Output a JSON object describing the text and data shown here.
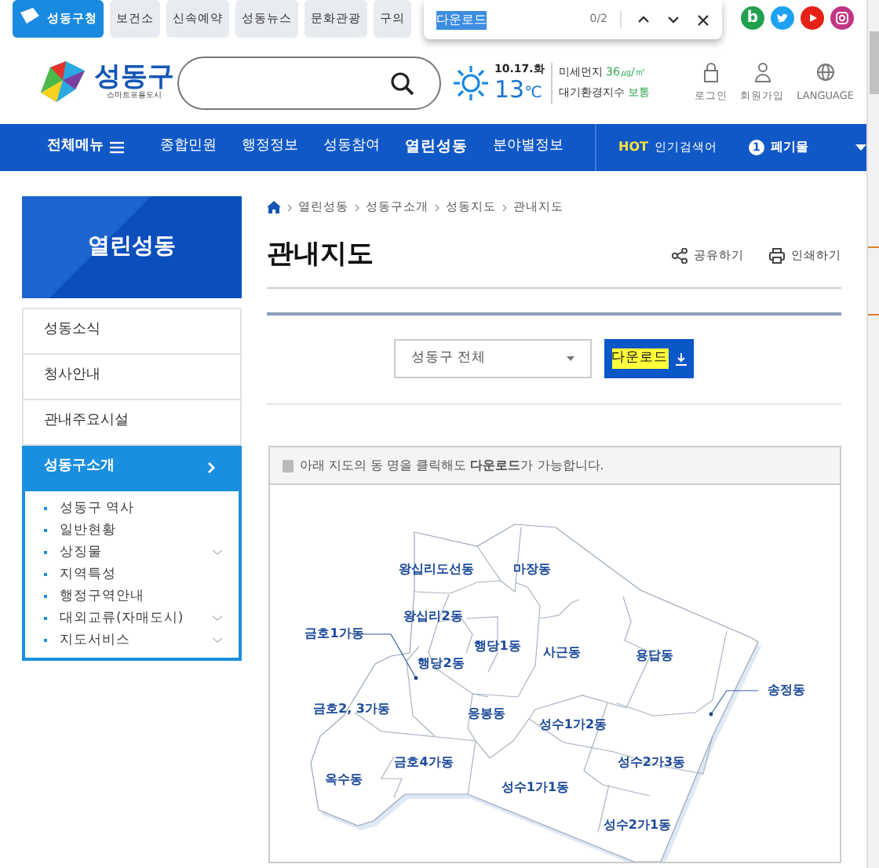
{
  "top_tabs": [
    {
      "label": "성동구청",
      "selected": true
    },
    {
      "label": "보건소",
      "selected": false
    },
    {
      "label": "신속예약",
      "selected": false
    },
    {
      "label": "성동뉴스",
      "selected": false
    },
    {
      "label": "문화관광",
      "selected": false
    },
    {
      "label": "구의",
      "selected": false
    }
  ],
  "find_bar": {
    "query": "다운로드",
    "count": "0/2"
  },
  "social_links": [
    {
      "kind": "blog",
      "glyph": "b"
    },
    {
      "kind": "twitter"
    },
    {
      "kind": "youtube"
    },
    {
      "kind": "instagram"
    }
  ],
  "logo": {
    "name": "성동구",
    "slogan": "스마트포용도시"
  },
  "weather": {
    "date": "10.17.화",
    "temperature": "13",
    "unit": "℃",
    "dust_label": "미세먼지",
    "dust_value": "36㎍/㎥",
    "air_label": "대기환경지수",
    "air_value": "보통"
  },
  "user_links": [
    {
      "kind": "login",
      "label": "로그인"
    },
    {
      "kind": "signup",
      "label": "회원가입"
    },
    {
      "kind": "language",
      "label": "LANGUAGE"
    }
  ],
  "main_nav": {
    "all_menu": "전체메뉴",
    "items": [
      {
        "label": "종합민원",
        "selected": false
      },
      {
        "label": "행정정보",
        "selected": false
      },
      {
        "label": "성동참여",
        "selected": false
      },
      {
        "label": "열린성동",
        "selected": true
      },
      {
        "label": "분야별정보",
        "selected": false
      }
    ],
    "hot_tag": "HOT",
    "hot_label": "인기검색어",
    "hot_rank": "1",
    "hot_keyword": "폐기물"
  },
  "sidebar": {
    "title": "열린성동",
    "items": [
      {
        "label": "성동소식",
        "selected": false
      },
      {
        "label": "청사안내",
        "selected": false
      },
      {
        "label": "관내주요시설",
        "selected": false
      },
      {
        "label": "성동구소개",
        "selected": true,
        "children": [
          {
            "label": "성동구 역사",
            "has_submenu": false
          },
          {
            "label": "일반현황",
            "has_submenu": false
          },
          {
            "label": "상징물",
            "has_submenu": true
          },
          {
            "label": "지역특성",
            "has_submenu": false
          },
          {
            "label": "행정구역안내",
            "has_submenu": false
          },
          {
            "label": "대외교류(자매도시)",
            "has_submenu": true
          },
          {
            "label": "지도서비스",
            "has_submenu": true
          }
        ]
      }
    ]
  },
  "breadcrumb": [
    "열린성동",
    "성동구소개",
    "성동지도",
    "관내지도"
  ],
  "page_title": "관내지도",
  "page_actions": [
    {
      "kind": "share",
      "label": "공유하기"
    },
    {
      "kind": "print",
      "label": "인쇄하기"
    }
  ],
  "district_select": {
    "value": "성동구 전체"
  },
  "download_button": {
    "label": "다운로드",
    "find_match": true
  },
  "notice": {
    "text": "아래 지도의 동 명을 클릭해도 **다운로드**가 가능합니다."
  },
  "map": {
    "districts": [
      "왕십리도선동",
      "마장동",
      "왕십리2동",
      "금호1가동",
      "행당1동",
      "행당2동",
      "사근동",
      "용답동",
      "송정동",
      "금호2, 3가동",
      "응봉동",
      "성수1가2동",
      "금호4가동",
      "성수2가3동",
      "옥수동",
      "성수1가1동",
      "성수2가1동"
    ]
  }
}
